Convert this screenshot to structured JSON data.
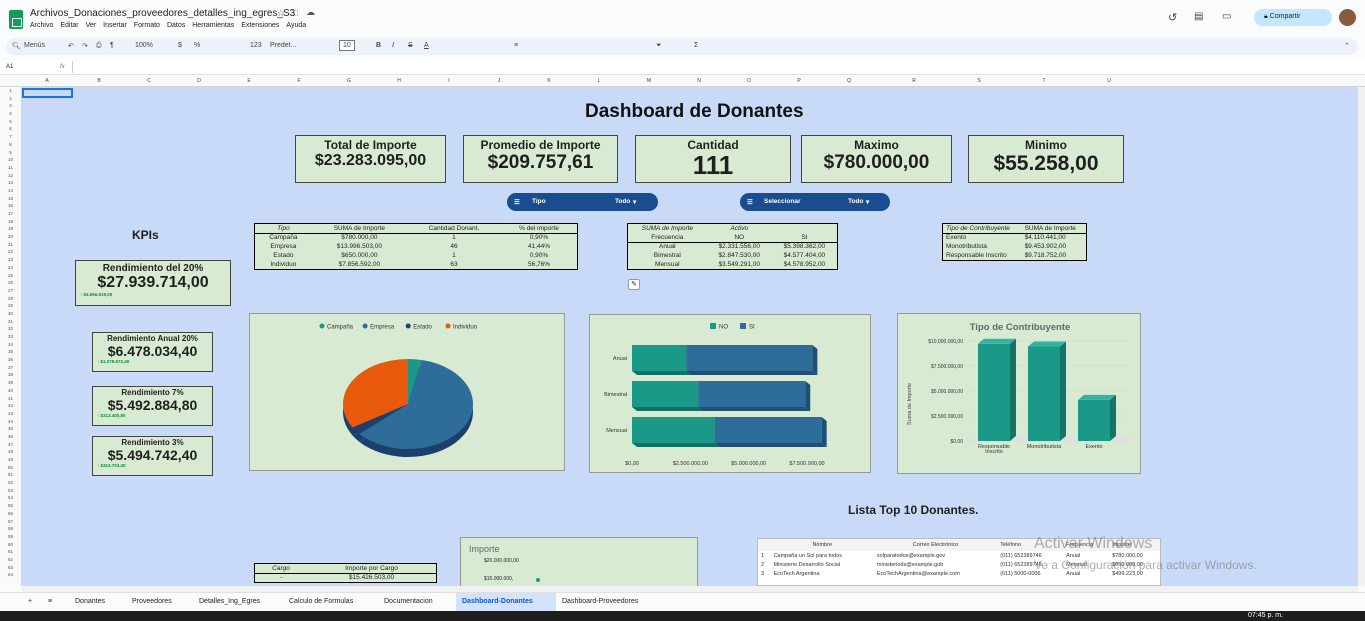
{
  "doc": {
    "title": "Archivos_Donaciones_proveedores_detalles_ing_egres_S3",
    "menus": [
      "Archivo",
      "Editar",
      "Ver",
      "Insertar",
      "Formato",
      "Datos",
      "Herramientas",
      "Extensiones",
      "Ayuda"
    ],
    "share": "Compartir"
  },
  "toolbar": {
    "menus": "Menús",
    "zoom": "100%",
    "font": "Predet...",
    "size": "10",
    "fmt123": "123"
  },
  "formula": {
    "cell": "A1",
    "fx": "fx"
  },
  "columns": [
    "A",
    "B",
    "C",
    "D",
    "E",
    "F",
    "G",
    "H",
    "I",
    "J",
    "K",
    "L",
    "M",
    "N",
    "O",
    "P",
    "Q",
    "R",
    "S",
    "T",
    "U"
  ],
  "dashboard": {
    "title": "Dashboard de Donantes",
    "kpis_label": "KPIs",
    "top10": "Lista Top 10 Donantes."
  },
  "kpis": [
    {
      "t": "Total de Importe",
      "v": "$23.283.095,00"
    },
    {
      "t": "Promedio de Importe",
      "v": "$209.757,61"
    },
    {
      "t": "Cantidad",
      "v": "111"
    },
    {
      "t": "Maximo",
      "v": "$780.000,00"
    },
    {
      "t": "Minimo",
      "v": "$55.258,00"
    }
  ],
  "filters": [
    {
      "label": "Tipo",
      "value": "Todo"
    },
    {
      "label": "Seleccionar",
      "value": "Todo"
    }
  ],
  "rend": [
    {
      "t": "Rendimiento del 20%",
      "v": "$27.939.714,00",
      "s": "↑ $4.656.619,00"
    },
    {
      "t": "Rendimiento Anual 20%",
      "v": "$6.478.034,40",
      "s": "↑ $1.079.672,40"
    },
    {
      "t": "Rendimiento  7%",
      "v": "$5.492.884,80",
      "s": "↑ $313.400,80"
    },
    {
      "t": "Rendimiento  3%",
      "v": "$5.494.742,40",
      "s": "↑ $313.703,40"
    }
  ],
  "table1": {
    "headers": [
      "Tipo",
      "SUMA de Importe",
      "Cantidad Donant.",
      "% del importe"
    ],
    "rows": [
      [
        "Campaña",
        "$780.000,00",
        "1",
        "0,90%"
      ],
      [
        "Empresa",
        "$13.996.503,00",
        "46",
        "41,44%"
      ],
      [
        "Estado",
        "$650.000,00",
        "1",
        "0,90%"
      ],
      [
        "Individuo",
        "$7.856.592,00",
        "63",
        "56,76%"
      ]
    ]
  },
  "table2": {
    "h1": [
      "SUMA de Importe",
      "Activo",
      ""
    ],
    "h2": [
      "Frecuencia",
      "NO",
      "SI"
    ],
    "rows": [
      [
        "Anual",
        "$2.331.556,00",
        "$5.398.362,00"
      ],
      [
        "Bimestral",
        "$2.847.530,00",
        "$4.577.404,00"
      ],
      [
        "Mensual",
        "$3.549.291,00",
        "$4.578.952,00"
      ]
    ]
  },
  "table3": {
    "headers": [
      "Tipo de Contribuyente",
      "SUMA de Importe"
    ],
    "rows": [
      [
        "Exento",
        "$4.110.441,00"
      ],
      [
        "Monotributista",
        "$9.453.902,00"
      ],
      [
        "Responsable Inscrito",
        "$9.718.752,00"
      ]
    ]
  },
  "table4": {
    "headers": [
      "Cargo",
      "Importe por Cargo"
    ],
    "rows": [
      [
        "-",
        "$15.426.503,00"
      ]
    ]
  },
  "pie": {
    "legend": [
      "Campaña",
      "Empresa",
      "Estado",
      "Individuo"
    ],
    "colors": [
      "#1a9988",
      "#2e6d99",
      "#1d3f6e",
      "#e8590c"
    ]
  },
  "bar": {
    "legend": [
      "NO",
      "SI"
    ],
    "colors": [
      "#1a9988",
      "#2e6d99"
    ],
    "cats": [
      "Anual",
      "Bimestral",
      "Mensual"
    ],
    "xticks": [
      "$0,00",
      "$2.500.000,00",
      "$5.000.000,00",
      "$7.500.000,00"
    ]
  },
  "col": {
    "title": "Tipo de Contribuyente",
    "ylabel": "Suma de Importe",
    "yticks": [
      "$10.000.000,00",
      "$7.500.000,00",
      "$5.000.000,00",
      "$2.500.000,00",
      "$0,00"
    ],
    "cats": [
      "Responsable Inscrito",
      "Monotributista",
      "Exento"
    ]
  },
  "imp": {
    "title": "Importe",
    "y1": "$20.000.000,00",
    "y2": "$15.000.000,"
  },
  "top": {
    "headers": [
      "Nombre",
      "Correo Electrónico",
      "Teléfono",
      "Frecuencia",
      "Importe"
    ],
    "rows": [
      [
        "1",
        "Campaña un Sol para todos",
        "solparatodos@example.gov",
        "(011) 652389746",
        "Anual",
        "$780.000,00"
      ],
      [
        "2",
        "Ministerio Desarrollo Social",
        "ministeriods@example.gob",
        "(011) 652389745",
        "Mensual",
        "$650.000,00"
      ],
      [
        "3",
        "EcoTech Argentina",
        "EcoTechArgentina@example.com",
        "(011) 5000-0006",
        "Anual",
        "$499.223,00"
      ]
    ]
  },
  "watermark": {
    "l1": "Activar Windows",
    "l2": "Ve a Configuración para activar Windows."
  },
  "sheets": [
    "Donantes",
    "Proveedores",
    "Detalles_Ing_Egres",
    "Calculo de Formulas",
    "Documentacion",
    "Dashboard-Donantes",
    "Dashboard-Proveedores"
  ],
  "clock": "07:45 p. m.",
  "chart_data": [
    {
      "type": "pie",
      "title": "",
      "categories": [
        "Campaña",
        "Empresa",
        "Estado",
        "Individuo"
      ],
      "values": [
        780000,
        13996503,
        650000,
        7856592
      ]
    },
    {
      "type": "bar",
      "title": "",
      "categories": [
        "Anual",
        "Bimestral",
        "Mensual"
      ],
      "series": [
        {
          "name": "NO",
          "values": [
            2331556,
            2847530,
            3549291
          ]
        },
        {
          "name": "SI",
          "values": [
            5398362,
            4577404,
            4578952
          ]
        }
      ],
      "xlim": [
        0,
        9000000
      ]
    },
    {
      "type": "bar",
      "title": "Tipo de Contribuyente",
      "ylabel": "Suma de Importe",
      "categories": [
        "Responsable Inscrito",
        "Monotributista",
        "Exento"
      ],
      "values": [
        9718752,
        9453902,
        4110441
      ],
      "ylim": [
        0,
        10000000
      ]
    }
  ]
}
